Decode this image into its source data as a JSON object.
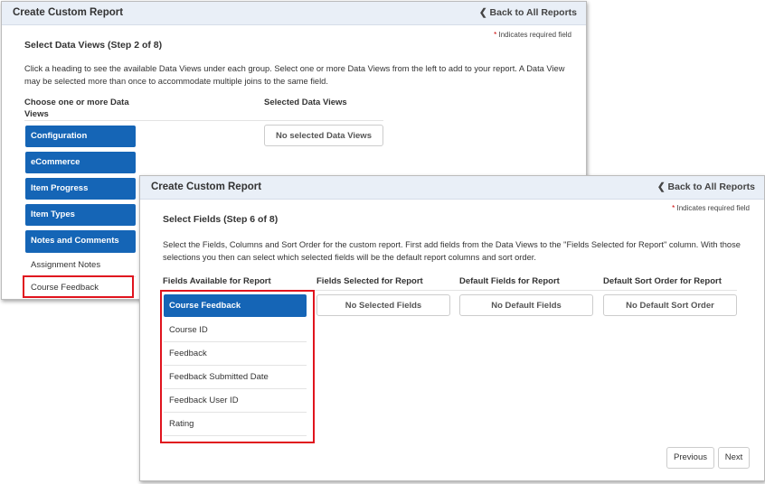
{
  "win1": {
    "title": "Create Custom Report",
    "back": "Back to All Reports",
    "required": "Indicates required field",
    "required_mark": "*",
    "heading": "Select Data Views (Step 2 of 8)",
    "desc": "Click a heading to see the available Data Views under each group. Select one or more Data Views from the left to add to your report. A Data View may be selected more than once to accommodate multiple joins to the same field.",
    "col_left": "Choose one or more Data Views",
    "col_right": "Selected Data Views",
    "empty": "No selected Data Views",
    "groups": [
      "Configuration",
      "eCommerce",
      "Item Progress",
      "Item Types",
      "Notes and Comments"
    ],
    "items": [
      "Assignment Notes",
      "Course Feedback"
    ]
  },
  "win2": {
    "title": "Create Custom Report",
    "back": "Back to All Reports",
    "required": "Indicates required field",
    "required_mark": "*",
    "heading": "Select Fields (Step 6 of 8)",
    "desc": "Select the Fields, Columns and Sort Order for the custom report. First add fields from the Data Views to the \"Fields Selected for Report\" column. With those selections you then can select which selected fields will be the default report columns and sort order.",
    "cols": [
      "Fields Available for Report",
      "Fields Selected for Report",
      "Default Fields for Report",
      "Default Sort Order for Report"
    ],
    "empty": [
      "No Selected Fields",
      "No Default Fields",
      "No Default Sort Order"
    ],
    "group": "Course Feedback",
    "fields": [
      "Course ID",
      "Feedback",
      "Feedback Submitted Date",
      "Feedback User ID",
      "Rating"
    ],
    "prev": "Previous",
    "next": "Next"
  }
}
